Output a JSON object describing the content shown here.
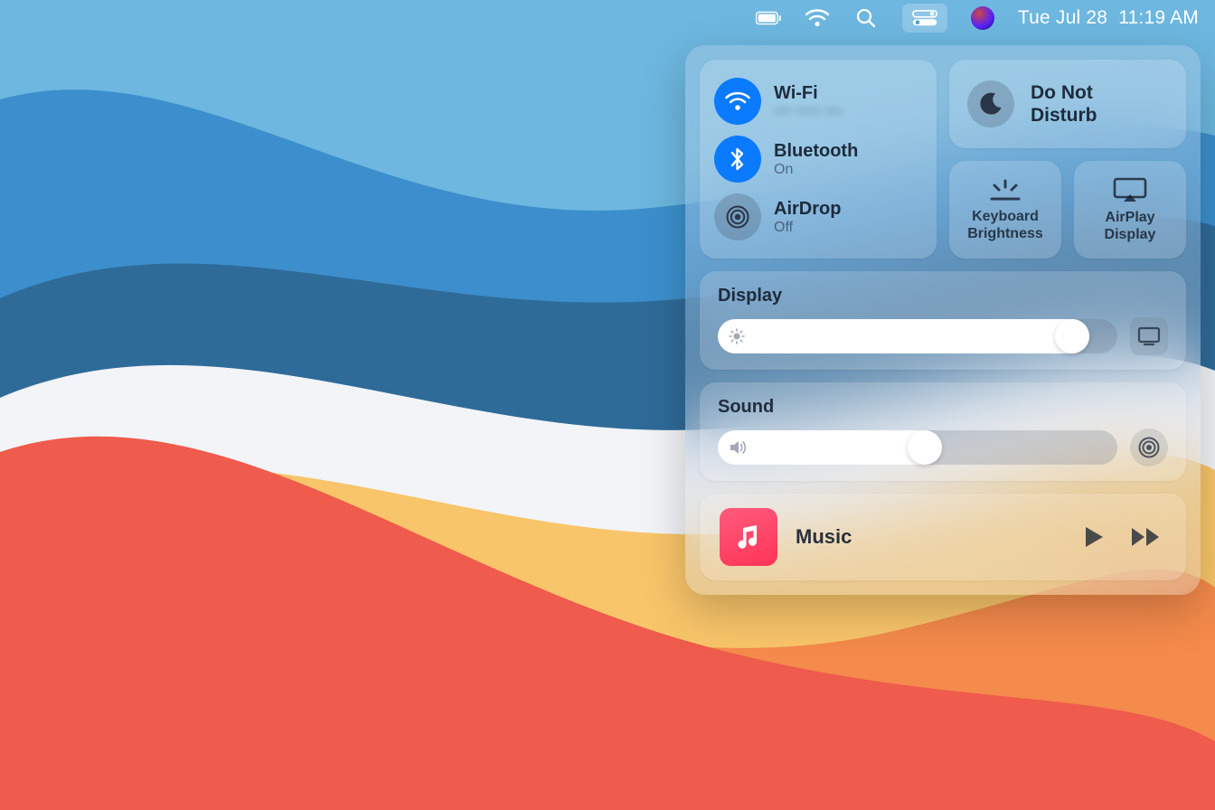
{
  "menubar": {
    "date": "Tue Jul 28",
    "time": "11:19 AM"
  },
  "connectivity": {
    "wifi": {
      "label": "Wi-Fi",
      "sub": "••• •••• •••",
      "active": true
    },
    "bluetooth": {
      "label": "Bluetooth",
      "sub": "On",
      "active": true
    },
    "airdrop": {
      "label": "AirDrop",
      "sub": "Off",
      "active": false
    }
  },
  "dnd": {
    "line1": "Do Not",
    "line2": "Disturb",
    "active": false
  },
  "keyboard_brightness": {
    "line1": "Keyboard",
    "line2": "Brightness"
  },
  "airplay": {
    "line1": "AirPlay",
    "line2": "Display"
  },
  "display": {
    "label": "Display",
    "percent": 93
  },
  "sound": {
    "label": "Sound",
    "percent": 56
  },
  "music": {
    "label": "Music"
  },
  "colors": {
    "accent": "#0a7aff"
  }
}
